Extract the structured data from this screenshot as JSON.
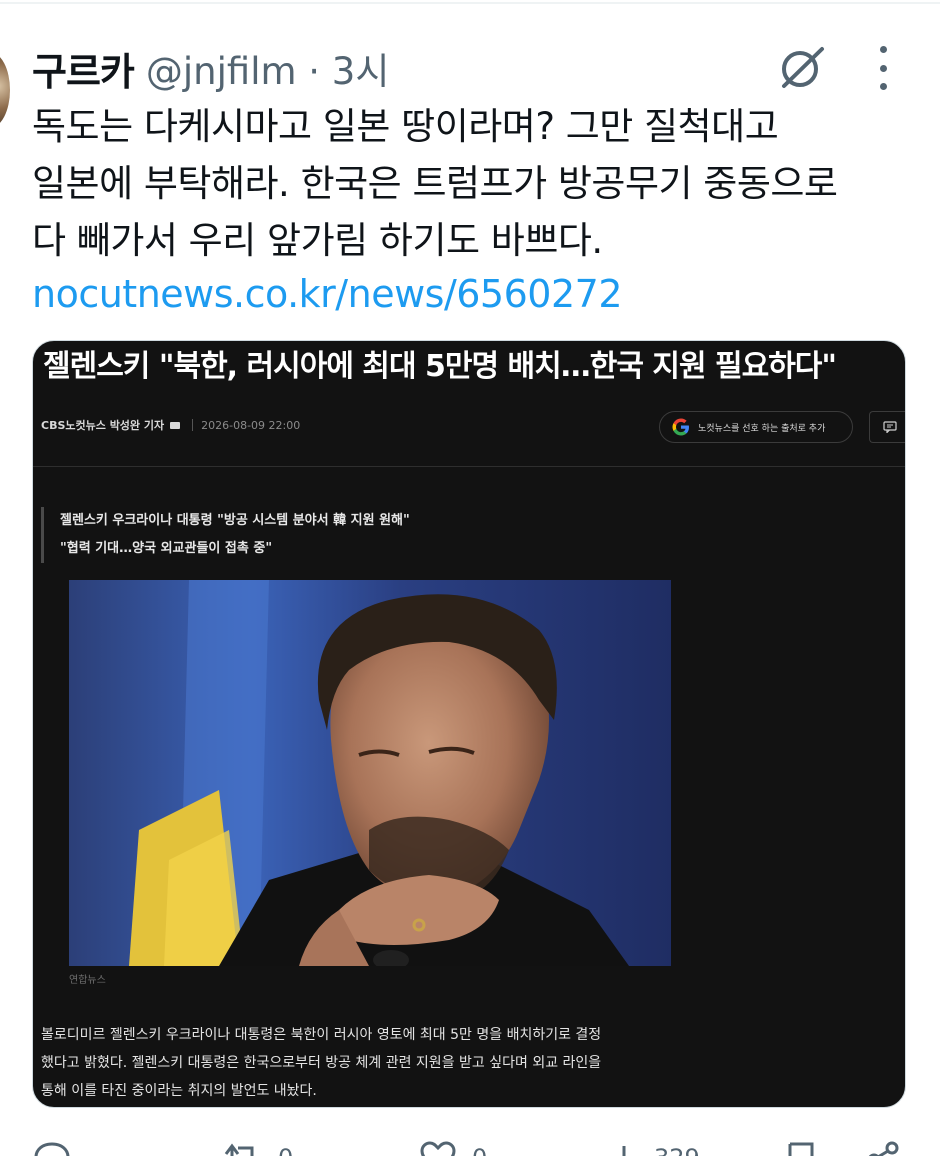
{
  "tweet": {
    "display_name": "구르카",
    "handle_time": "@jnjfilm · 3시",
    "text_lines": [
      "독도는 다케시마고 일본 땅이라며? 그만 질척대고",
      "일본에 부탁해라. 한국은 트럼프가 방공무기 중동으로",
      "다 빼가서 우리 앞가림 하기도 바쁘다."
    ],
    "link": "nocutnews.co.kr/news/6560272"
  },
  "card": {
    "headline": "젤렌스키 \"북한, 러시아에 최대 5만명 배치…한국 지원 필요하다\"",
    "reporter": "CBS노컷뉴스 박성완 기자",
    "timestamp": "2026-08-09 22:00",
    "google_button": "노컷뉴스를 선호 하는 출처로 추가",
    "subtitles": [
      "젤렌스키 우크라이나 대통령 \"방공 시스템 분야서 韓 지원 원해\"",
      "\"협력 기대…양국 외교관들이 접촉 중\""
    ],
    "photo_credit": "연합뉴스",
    "body_lines": [
      "볼로디미르 젤렌스키 우크라이나 대통령은 북한이 러시아 영토에 최대 5만 명을 배치하기로 결정",
      "했다고 밝혔다. 젤렌스키 대통령은 한국으로부터 방공 체계 관련 지원을 받고 싶다며 외교 라인을",
      "통해 이를 타진 중이라는 취지의 발언도 내놨다."
    ]
  },
  "actions": {
    "reply_count": "",
    "repost_count": "0",
    "like_count": "0",
    "views_count": "329"
  },
  "icons": {
    "grok": "grok-icon",
    "more": "more-dots-icon",
    "google": "google-g-icon",
    "comment": "comment-icon",
    "reply": "reply-icon",
    "repost": "repost-icon",
    "like": "heart-icon",
    "views": "views-icon",
    "bookmark": "bookmark-icon",
    "share": "share-icon"
  },
  "colors": {
    "link": "#1d9bf0",
    "text": "#0f1419",
    "secondary": "#536471",
    "card_bg": "#121212"
  }
}
